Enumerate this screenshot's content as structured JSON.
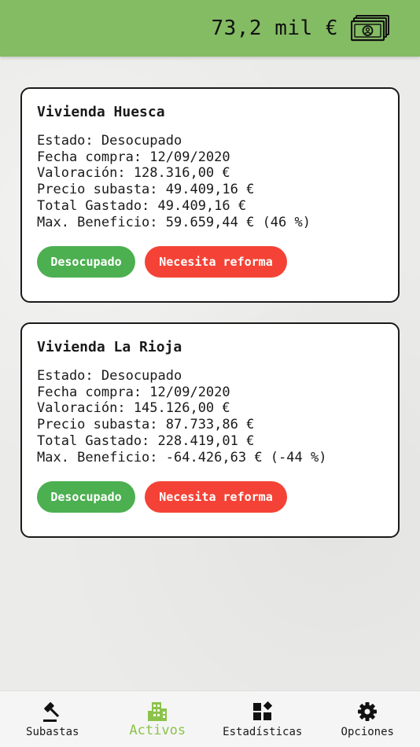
{
  "header": {
    "balance": "73,2 mil €",
    "color": "#84bc63",
    "icon": "money-icon"
  },
  "properties": [
    {
      "title": "Vivienda Huesca",
      "estado": "Estado: Desocupado",
      "fecha": "Fecha compra: 12/09/2020",
      "valoracion": "Valoración: 128.316,00 €",
      "precio": "Precio subasta: 49.409,16 €",
      "gastado": "Total Gastado: 49.409,16 €",
      "beneficio": "Max. Beneficio: 59.659,44 € (46 %)",
      "tags": [
        "Desocupado",
        "Necesita reforma"
      ]
    },
    {
      "title": "Vivienda La Rioja",
      "estado": "Estado: Desocupado",
      "fecha": "Fecha compra: 12/09/2020",
      "valoracion": "Valoración: 145.126,00 €",
      "precio": "Precio subasta: 87.733,86 €",
      "gastado": "Total Gastado: 228.419,01 €",
      "beneficio": "Max. Beneficio: -64.426,63 € (-44 %)",
      "tags": [
        "Desocupado",
        "Necesita reforma"
      ]
    }
  ],
  "tag_colors": {
    "occupancy": "#4caf50",
    "reform": "#f44336"
  },
  "nav": {
    "active_color": "#8bc34a",
    "items": [
      {
        "label": "Subastas",
        "icon": "gavel-icon"
      },
      {
        "label": "Activos",
        "icon": "buildings-icon"
      },
      {
        "label": "Estadísticas",
        "icon": "widgets-icon"
      },
      {
        "label": "Opciones",
        "icon": "gear-icon"
      }
    ]
  }
}
